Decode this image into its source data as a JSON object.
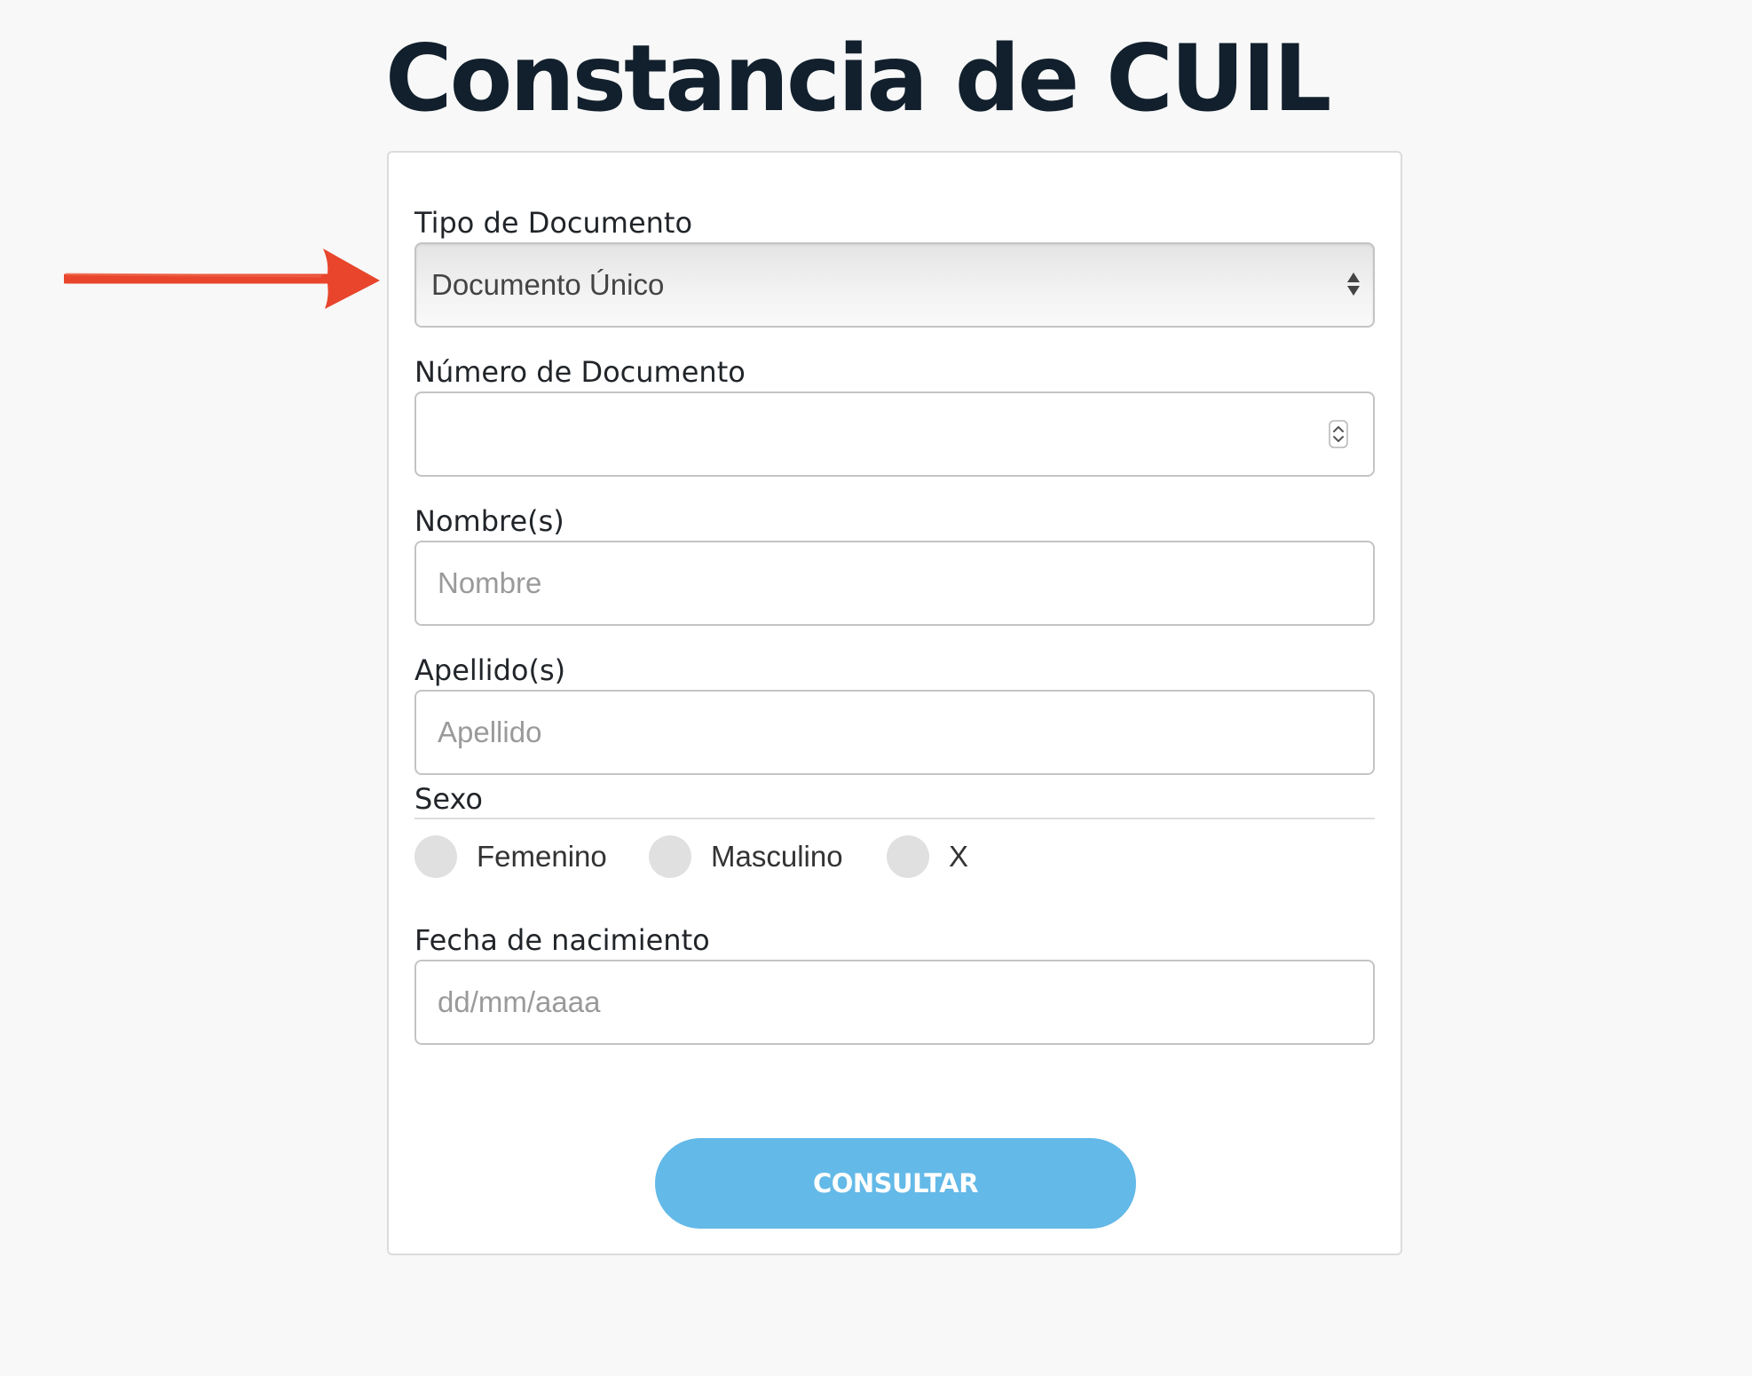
{
  "page": {
    "title": "Constancia de CUIL"
  },
  "form": {
    "tipo_documento": {
      "label": "Tipo de Documento",
      "selected": "Documento Único"
    },
    "numero_documento": {
      "label": "Número de Documento",
      "value": ""
    },
    "nombre": {
      "label": "Nombre(s)",
      "placeholder": "Nombre",
      "value": ""
    },
    "apellido": {
      "label": "Apellido(s)",
      "placeholder": "Apellido",
      "value": ""
    },
    "sexo": {
      "label": "Sexo",
      "options": [
        "Femenino",
        "Masculino",
        "X"
      ],
      "selected": null
    },
    "fecha_nacimiento": {
      "label": "Fecha de nacimiento",
      "placeholder": "dd/mm/aaaa",
      "value": ""
    },
    "submit_label": "CONSULTAR"
  },
  "annotation": {
    "icon": "red-arrow-icon",
    "color": "#e8452c"
  },
  "colors": {
    "title": "#12202d",
    "button": "#63b9e7",
    "background": "#f8f8f8"
  }
}
